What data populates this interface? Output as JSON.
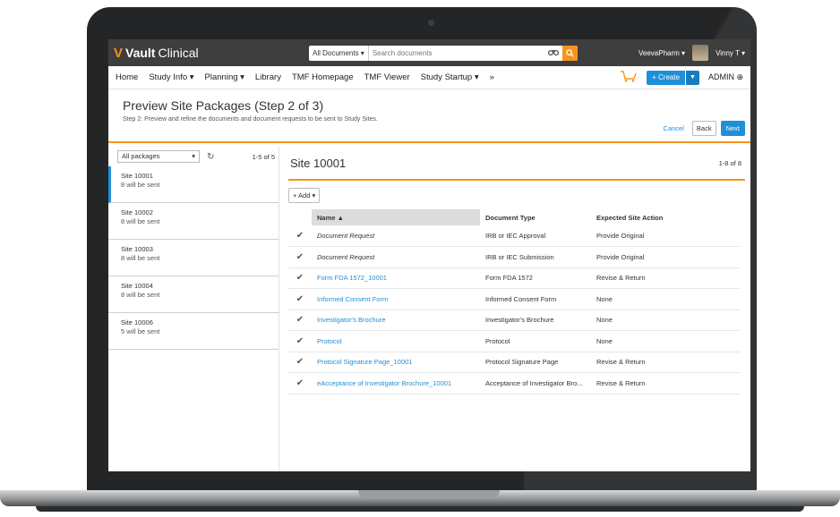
{
  "app": {
    "logo_mark": "V",
    "logo_bold": "Vault",
    "logo_light": "Clinical"
  },
  "search": {
    "scope": "All Documents ▾",
    "placeholder": "Search documents"
  },
  "topbar": {
    "org": "VeevaPharm ▾",
    "user": "Vinny T ▾"
  },
  "nav": {
    "items": [
      "Home",
      "Study Info ▾",
      "Planning ▾",
      "Library",
      "TMF Homepage",
      "TMF Viewer",
      "Study Startup ▾",
      "»"
    ],
    "create_label": "+ Create",
    "admin_label": "ADMIN ⊕"
  },
  "header": {
    "title": "Preview Site Packages (Step 2 of 3)",
    "subtitle": "Step 2: Preview and refine the documents and document requests to be sent to Study Sites.",
    "cancel": "Cancel",
    "back": "Back",
    "next": "Next"
  },
  "left": {
    "filter": "All packages",
    "count": "1-5 of 5",
    "sites": [
      {
        "name": "Site 10001",
        "sub": "8 will be sent"
      },
      {
        "name": "Site 10002",
        "sub": "8 will be sent"
      },
      {
        "name": "Site 10003",
        "sub": "8 will be sent"
      },
      {
        "name": "Site 10004",
        "sub": "8 will be sent"
      },
      {
        "name": "Site 10006",
        "sub": "5 will be sent"
      }
    ]
  },
  "main": {
    "site_title": "Site 10001",
    "count": "1-8 of 8",
    "add_label": "+ Add ▾",
    "columns": [
      "Name ▲",
      "Document Type",
      "Expected Site Action"
    ],
    "rows": [
      {
        "name": "Document Request",
        "type": "IRB or IEC Approval",
        "action": "Provide Original"
      },
      {
        "name": "Document Request",
        "type": "IRB or IEC Submission",
        "action": "Provide Original"
      },
      {
        "name": "Form FDA 1572_10001",
        "type": "Form FDA 1572",
        "action": "Revise & Return"
      },
      {
        "name": "Informed Consent Form",
        "type": "Informed Consent Form",
        "action": "None"
      },
      {
        "name": "Investigator's Brochure",
        "type": "Investigator's Brochure",
        "action": "None"
      },
      {
        "name": "Protocol",
        "type": "Protocol",
        "action": "None"
      },
      {
        "name": "Protocol Signature Page_10001",
        "type": "Protocol Signature Page",
        "action": "Revise & Return"
      },
      {
        "name": "eAcceptance of Investigator Brochure_10001",
        "type": "Acceptance of Investigator Bro...",
        "action": "Revise & Return"
      }
    ]
  }
}
